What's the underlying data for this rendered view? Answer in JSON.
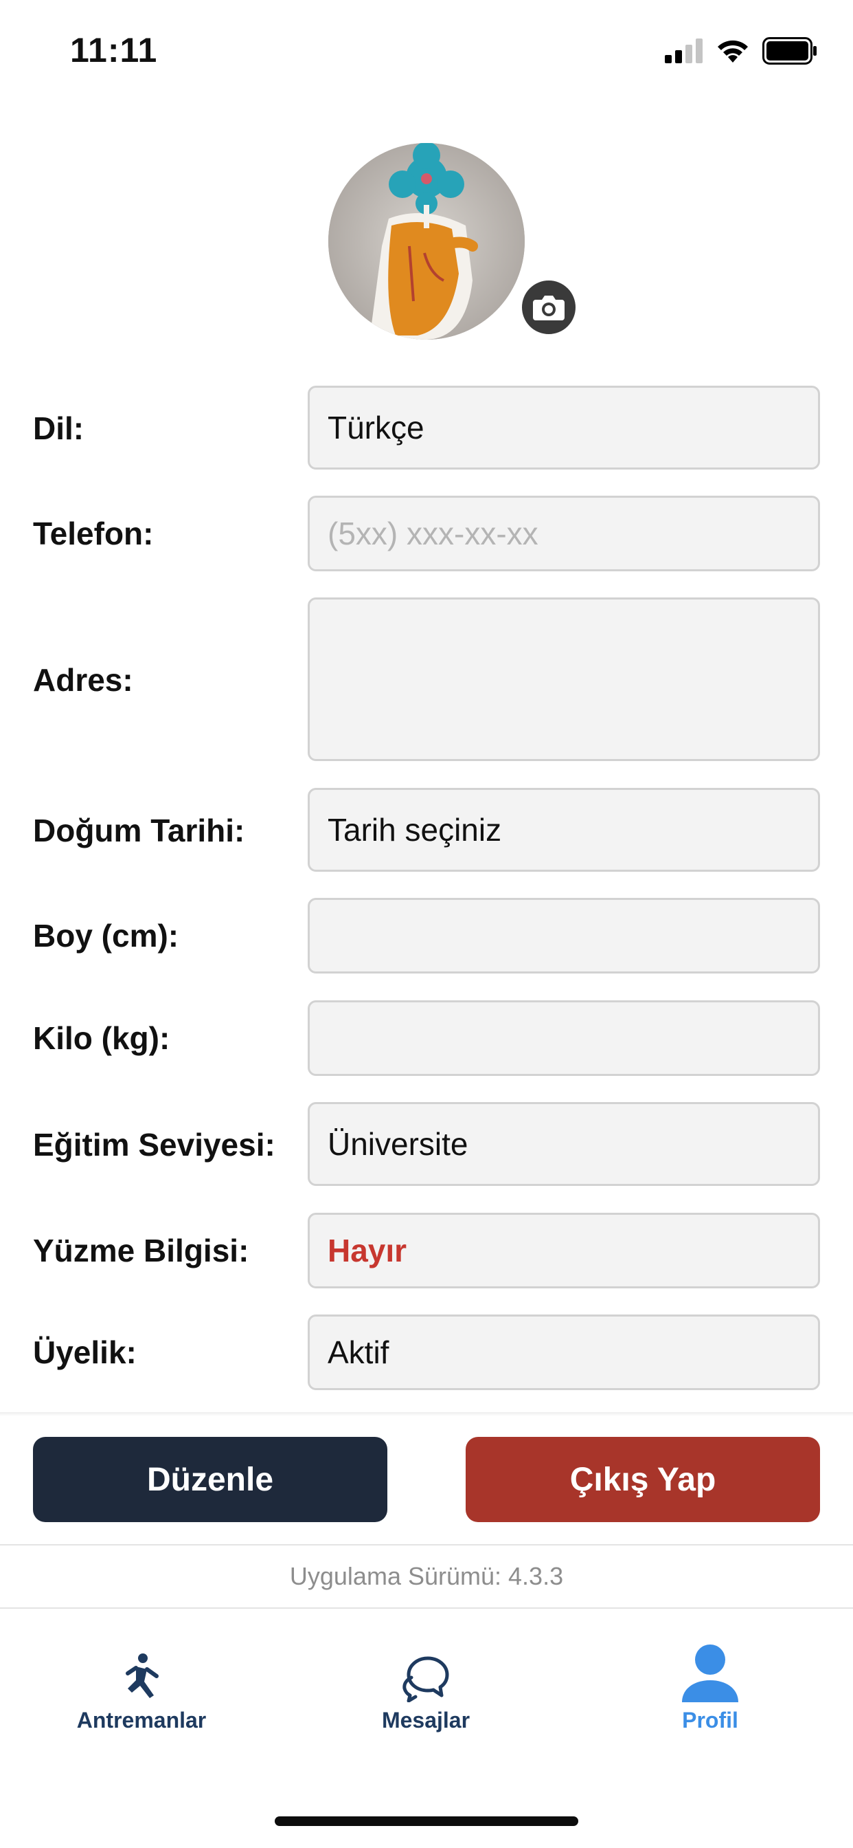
{
  "status_bar": {
    "time": "11:11"
  },
  "profile": {
    "avatar_icon": "camera-icon"
  },
  "form": {
    "language": {
      "label": "Dil:",
      "value": "Türkçe"
    },
    "phone": {
      "label": "Telefon:",
      "placeholder": "(5xx) xxx-xx-xx"
    },
    "address": {
      "label": "Adres:",
      "value": ""
    },
    "birth_date": {
      "label": "Doğum Tarihi:",
      "value": "Tarih seçiniz"
    },
    "height": {
      "label": "Boy (cm):",
      "value": ""
    },
    "weight": {
      "label": "Kilo (kg):",
      "value": ""
    },
    "education": {
      "label": "Eğitim Seviyesi:",
      "value": "Üniversite"
    },
    "swimming": {
      "label": "Yüzme Bilgisi:",
      "value": "Hayır"
    },
    "membership": {
      "label": "Üyelik:",
      "value": "Aktif"
    }
  },
  "actions": {
    "edit_label": "Düzenle",
    "logout_label": "Çıkış Yap"
  },
  "version_text": "Uygulama Sürümü: 4.3.3",
  "tabs": [
    {
      "label": "Antremanlar",
      "icon": "exercise-icon",
      "active": false
    },
    {
      "label": "Mesajlar",
      "icon": "chat-bubbles-icon",
      "active": false
    },
    {
      "label": "Profil",
      "icon": "person-icon",
      "active": true
    }
  ],
  "colors": {
    "dark_button": "#1e293b",
    "logout_button": "#a8352a",
    "active_tab": "#3b8ee6",
    "inactive_tab": "#1e3a5f",
    "swim_value": "#c7372f"
  }
}
